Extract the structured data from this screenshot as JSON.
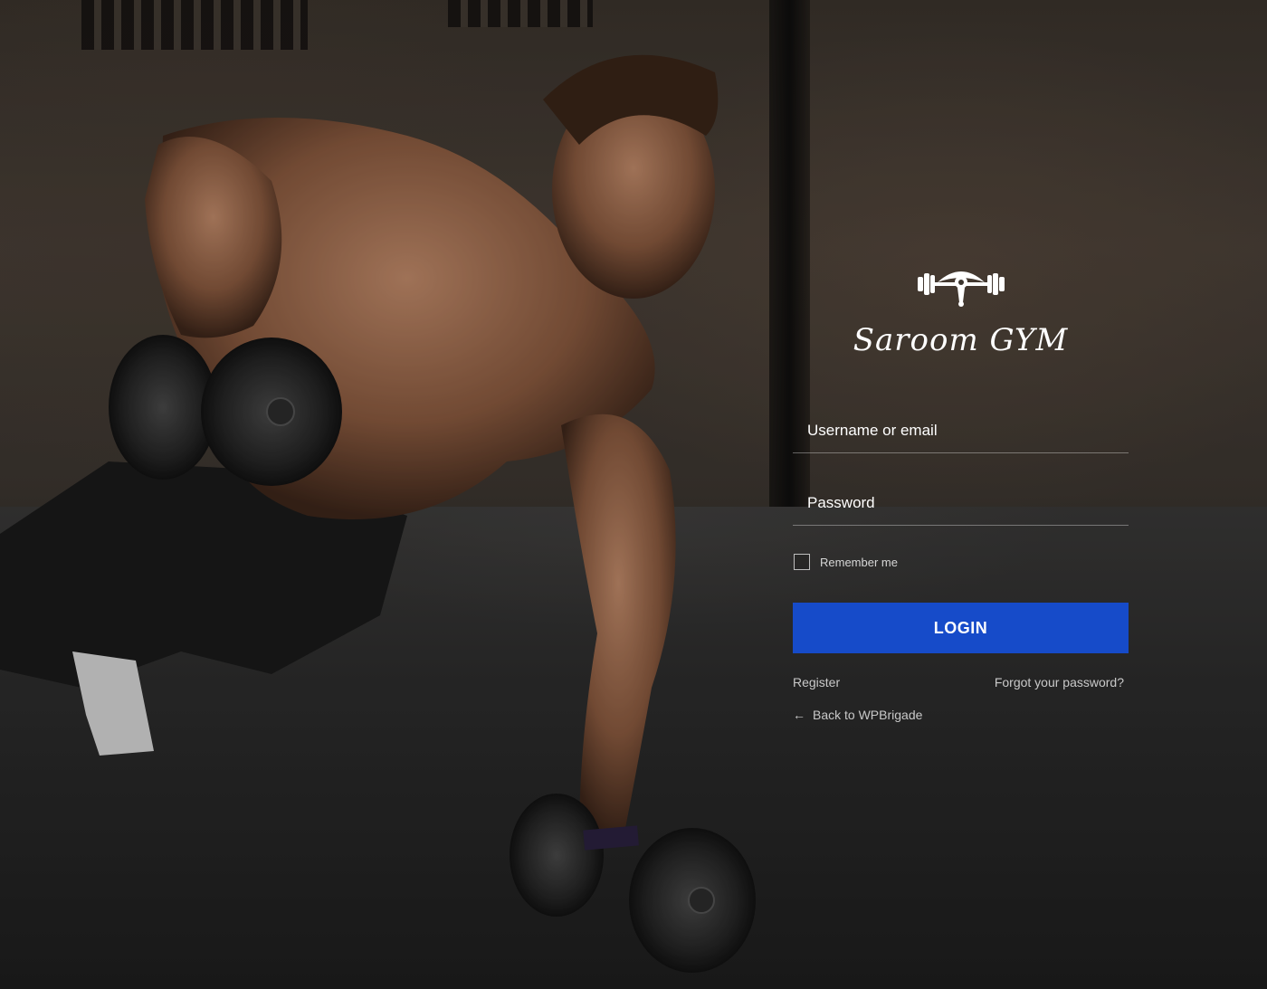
{
  "brand": {
    "name": "Saroom GYM",
    "logo_icon": "dumbbell-eye-icon"
  },
  "form": {
    "username_placeholder": "Username or email",
    "username_value": "",
    "password_placeholder": "Password",
    "password_value": "",
    "remember_label": "Remember me",
    "remember_checked": false,
    "login_label": "LOGIN"
  },
  "links": {
    "register": "Register",
    "forgot": "Forgot your password?",
    "back": "Back to WPBrigade",
    "back_icon": "arrow-left-icon"
  },
  "colors": {
    "accent": "#164bc9",
    "text": "#ffffff"
  }
}
